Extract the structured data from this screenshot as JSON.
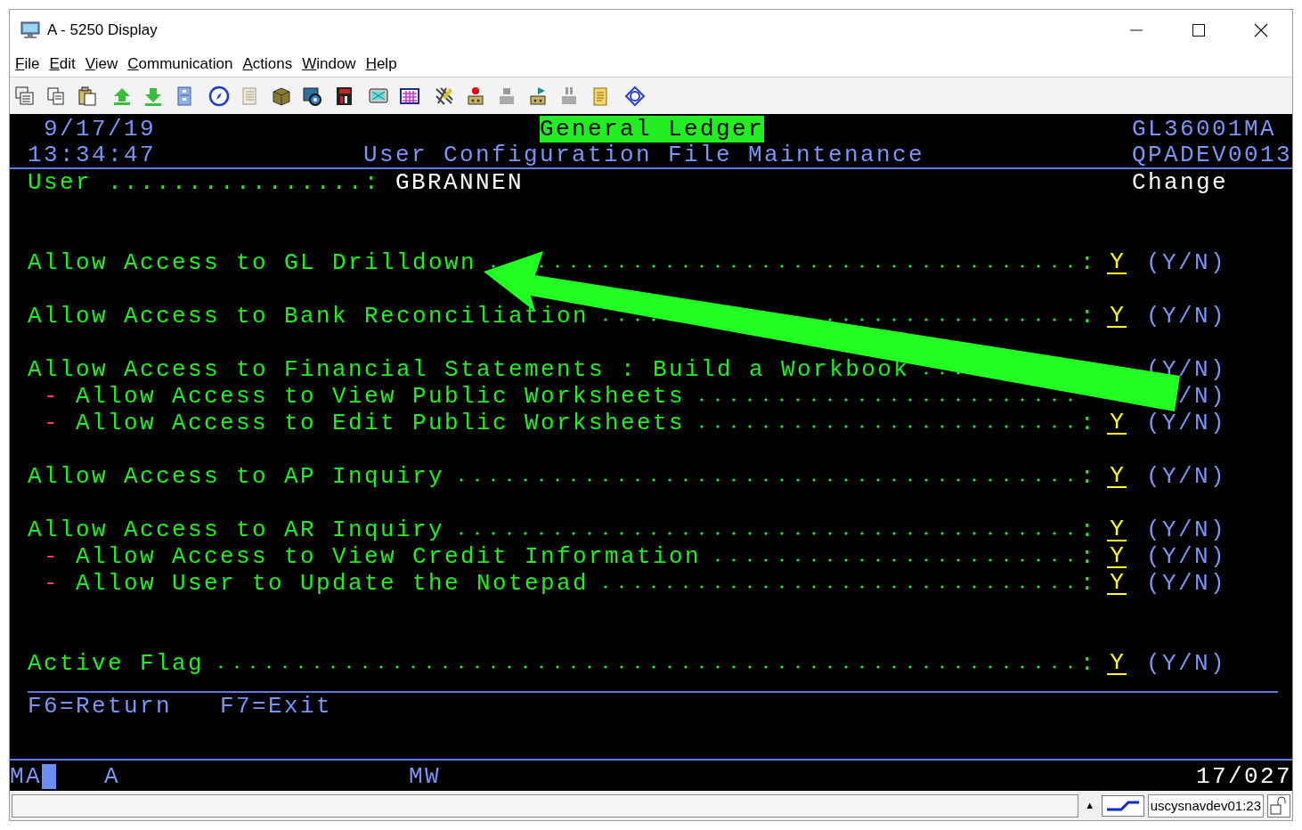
{
  "window": {
    "title": "A - 5250 Display"
  },
  "menu": [
    "File",
    "Edit",
    "View",
    "Communication",
    "Actions",
    "Window",
    "Help"
  ],
  "screen": {
    "date": "9/17/19",
    "program_title": "General Ledger",
    "program_id": "GL36001MA",
    "time": "13:34:47",
    "screen_title": "User Configuration File Maintenance",
    "device": "QPADEV0013",
    "user_label": "User ................:",
    "user_value": "GBRANNEN",
    "mode": "Change",
    "groups": [
      {
        "kind": "option",
        "fields": [
          {
            "kind": "main",
            "label": "Allow Access to GL Drilldown",
            "separator": ":",
            "value": "Y",
            "hint": "(Y/N)"
          }
        ]
      },
      {
        "kind": "option",
        "fields": [
          {
            "kind": "main",
            "label": "Allow Access to Bank Reconciliation",
            "separator": ":",
            "value": "Y",
            "hint": "(Y/N)"
          }
        ]
      },
      {
        "kind": "option",
        "fields": [
          {
            "kind": "main",
            "label": "Allow Access to Financial Statements : Build a Workbook",
            "hint": "(Y/N)"
          },
          {
            "kind": "sub",
            "marker": "-",
            "label": "Allow Access to View Public Worksheets",
            "hint": "/N)"
          },
          {
            "kind": "sub",
            "marker": "-",
            "label": "Allow Access to Edit Public Worksheets",
            "separator": ":",
            "value": "Y",
            "hint": "(Y/N)"
          }
        ]
      },
      {
        "kind": "option",
        "fields": [
          {
            "kind": "main",
            "label": "Allow Access to AP Inquiry",
            "separator": ":",
            "value": "Y",
            "hint": "(Y/N)"
          }
        ]
      },
      {
        "kind": "option",
        "fields": [
          {
            "kind": "main",
            "label": "Allow Access to AR Inquiry",
            "separator": ":",
            "value": "Y",
            "hint": "(Y/N)"
          },
          {
            "kind": "sub",
            "marker": "-",
            "label": "Allow Access to View Credit Information",
            "separator": ":",
            "value": "Y",
            "hint": "(Y/N)"
          },
          {
            "kind": "sub",
            "marker": "-",
            "label": "Allow User to Update the Notepad",
            "separator": ":",
            "value": "Y",
            "hint": "(Y/N)"
          }
        ]
      },
      {
        "kind": "flag",
        "fields": [
          {
            "kind": "main",
            "label": "Active Flag",
            "separator": ":",
            "value": "Y",
            "hint": "(Y/N)"
          }
        ]
      }
    ],
    "function_keys": [
      "F6=Return",
      "F7=Exit"
    ]
  },
  "operator_info": {
    "mode": "MA",
    "indicator": "A",
    "session": "MW",
    "position": "17/027"
  },
  "status_bar": {
    "scroll_arrow": "▲",
    "host": "uscysnavdev01:23"
  }
}
